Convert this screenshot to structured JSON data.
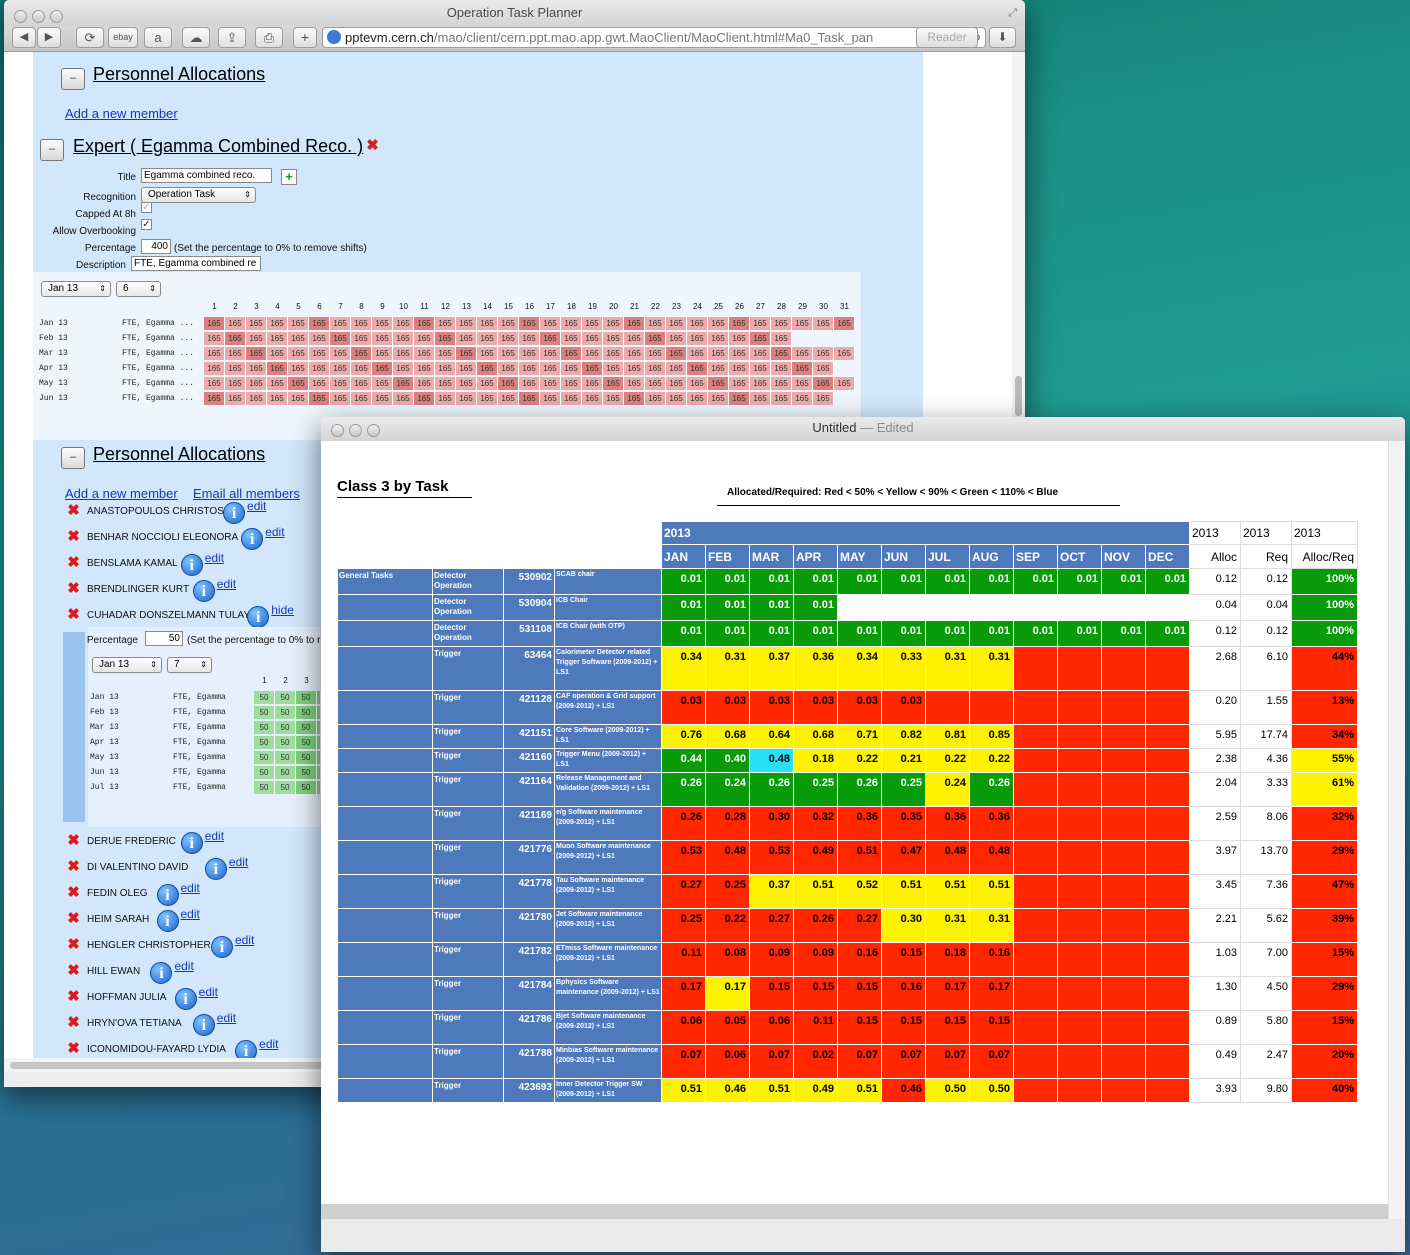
{
  "browser": {
    "title": "Operation Task Planner",
    "toolbar": {
      "ebay": "ebay",
      "reader": "Reader"
    },
    "url_host": "pptevm.cern.ch",
    "url_path": "/mao/client/cern.ppt.mao.app.gwt.MaoClient/MaoClient.html#Ma0_Task_pan",
    "minus_label": "–",
    "personnel1": {
      "title": "Personnel Allocations",
      "add_member": "Add a new member"
    },
    "expert": {
      "title": "Expert ( Egamma Combined Reco. )",
      "labels": {
        "title": "Title",
        "recognition": "Recognition",
        "capped": "Capped At 8h",
        "overbooking": "Allow Overbooking",
        "percentage": "Percentage",
        "description": "Description"
      },
      "title_value": "Egamma combined reco.",
      "recognition_value": "Operation Task",
      "percentage_value": "400",
      "percentage_note": "(Set the percentage to 0% to remove shifts)",
      "description_value": "FTE, Egamma combined re",
      "month_select": "Jan 13",
      "count_select": "6",
      "days": [
        "1",
        "2",
        "3",
        "4",
        "5",
        "6",
        "7",
        "8",
        "9",
        "10",
        "11",
        "12",
        "13",
        "14",
        "15",
        "16",
        "17",
        "18",
        "19",
        "20",
        "21",
        "22",
        "23",
        "24",
        "25",
        "26",
        "27",
        "28",
        "29",
        "30",
        "31"
      ],
      "rows": [
        {
          "month": "Jan 13",
          "label": "FTE, Egamma ...",
          "days": 31,
          "value": "165"
        },
        {
          "month": "Feb 13",
          "label": "FTE, Egamma ...",
          "days": 28,
          "value": "165"
        },
        {
          "month": "Mar 13",
          "label": "FTE, Egamma ...",
          "days": 31,
          "value": "165"
        },
        {
          "month": "Apr 13",
          "label": "FTE, Egamma ...",
          "days": 30,
          "value": "165"
        },
        {
          "month": "May 13",
          "label": "FTE, Egamma ...",
          "days": 31,
          "value": "165"
        },
        {
          "month": "Jun 13",
          "label": "FTE, Egamma ...",
          "days": 30,
          "value": "165"
        }
      ]
    },
    "personnel2": {
      "title": "Personnel Allocations",
      "add_member": "Add a new member",
      "email_all": "Email all members",
      "edit": "edit",
      "hide": "hide",
      "members_top": [
        "ANASTOPOULOS CHRISTOS",
        "BENHAR NOCCIOLI ELEONORA",
        "BENSLAMA KAMAL",
        "BRENDLINGER KURT",
        "CUHADAR DONSZELMANN TULAY"
      ],
      "sub": {
        "percentage_label": "Percentage",
        "percentage_value": "50",
        "note": "(Set the percentage to 0% to r",
        "month_select": "Jan 13",
        "count_select": "7",
        "days": [
          "1",
          "2",
          "3"
        ],
        "rows": [
          {
            "month": "Jan 13",
            "label": "FTE, Egamma"
          },
          {
            "month": "Feb 13",
            "label": "FTE, Egamma"
          },
          {
            "month": "Mar 13",
            "label": "FTE, Egamma"
          },
          {
            "month": "Apr 13",
            "label": "FTE, Egamma"
          },
          {
            "month": "May 13",
            "label": "FTE, Egamma"
          },
          {
            "month": "Jun 13",
            "label": "FTE, Egamma"
          },
          {
            "month": "Jul 13",
            "label": "FTE, Egamma"
          }
        ],
        "value": "50"
      },
      "members_bottom": [
        "DERUE FREDERIC",
        "DI VALENTINO DAVID",
        "FEDIN OLEG",
        "HEIM SARAH",
        "HENGLER CHRISTOPHER",
        "HILL EWAN",
        "HOFFMAN JULIA",
        "HRYN'OVA TETIANA",
        "ICONOMIDOU-FAYARD LYDIA"
      ]
    }
  },
  "editor": {
    "title": "Untitled",
    "edited": "— Edited",
    "report_title": "Class 3 by Task",
    "legend": "Allocated/Required: Red < 50% < Yellow < 90% < Green < 110% < Blue",
    "year": "2013",
    "months": [
      "JAN",
      "FEB",
      "MAR",
      "APR",
      "MAY",
      "JUN",
      "JUL",
      "AUG",
      "SEP",
      "OCT",
      "NOV",
      "DEC"
    ],
    "col_heads": [
      "Alloc",
      "Req",
      "Alloc/Req"
    ],
    "group": "General Tasks",
    "colors": {
      "R": "#ff2600",
      "Y": "#fff200",
      "G": "#0a9b0a",
      "B": "#27e0f5",
      "header": "#4e79bb"
    },
    "rows": [
      {
        "cat": "Detector Operation",
        "id": "530902",
        "desc": "SCAB chair",
        "vals": [
          "0.01",
          "0.01",
          "0.01",
          "0.01",
          "0.01",
          "0.01",
          "0.01",
          "0.01",
          "0.01",
          "0.01",
          "0.01",
          "0.01"
        ],
        "cls": "GGGGGGGGGGGG",
        "alloc": "0.12",
        "req": "0.12",
        "pct": "100%",
        "pcls": "G"
      },
      {
        "cat": "Detector Operation",
        "id": "530904",
        "desc": "ICB Chair",
        "vals": [
          "0.01",
          "0.01",
          "0.01",
          "0.01",
          "",
          "",
          "",
          "",
          "",
          "",
          "",
          ""
        ],
        "cls": "GGGGWWWWWWWW",
        "alloc": "0.04",
        "req": "0.04",
        "pct": "100%",
        "pcls": "G"
      },
      {
        "cat": "Detector Operation",
        "id": "531108",
        "desc": "ICB Chair (with OTP)",
        "vals": [
          "0.01",
          "0.01",
          "0.01",
          "0.01",
          "0.01",
          "0.01",
          "0.01",
          "0.01",
          "0.01",
          "0.01",
          "0.01",
          "0.01"
        ],
        "cls": "GGGGGGGGGGGG",
        "alloc": "0.12",
        "req": "0.12",
        "pct": "100%",
        "pcls": "G"
      },
      {
        "cat": "Trigger",
        "id": "63464",
        "desc": "Calorimeter Detector related Trigger Software (2009-2012) + LS1",
        "vals": [
          "0.34",
          "0.31",
          "0.37",
          "0.36",
          "0.34",
          "0.33",
          "0.31",
          "0.31",
          "",
          "",
          "",
          ""
        ],
        "cls": "YYYYYYYYRRRR",
        "alloc": "2.68",
        "req": "6.10",
        "pct": "44%",
        "pcls": "R"
      },
      {
        "cat": "Trigger",
        "id": "421128",
        "desc": "CAF operation & Grid support (2009-2012) + LS1",
        "vals": [
          "0.03",
          "0.03",
          "0.03",
          "0.03",
          "0.03",
          "0.03",
          "",
          "",
          "",
          "",
          "",
          ""
        ],
        "cls": "RRRRRRRRRRRR",
        "alloc": "0.20",
        "req": "1.55",
        "pct": "13%",
        "pcls": "R"
      },
      {
        "cat": "Trigger",
        "id": "421151",
        "desc": "Core Software (2009-2012) + LS1",
        "vals": [
          "0.76",
          "0.68",
          "0.64",
          "0.68",
          "0.71",
          "0.82",
          "0.81",
          "0.85",
          "",
          "",
          "",
          ""
        ],
        "cls": "YYYYYYYYRRRR",
        "alloc": "5.95",
        "req": "17.74",
        "pct": "34%",
        "pcls": "R"
      },
      {
        "cat": "Trigger",
        "id": "421160",
        "desc": "Trigger Menu (2009-2012) + LS1",
        "vals": [
          "0.44",
          "0.40",
          "0.48",
          "0.18",
          "0.22",
          "0.21",
          "0.22",
          "0.22",
          "",
          "",
          "",
          ""
        ],
        "cls": "GGBYYYYYRRRR",
        "alloc": "2.38",
        "req": "4.36",
        "pct": "55%",
        "pcls": "Y"
      },
      {
        "cat": "Trigger",
        "id": "421164",
        "desc": "Release Management and Validation (2009-2012) + LS1",
        "vals": [
          "0.26",
          "0.24",
          "0.26",
          "0.25",
          "0.26",
          "0.25",
          "0.24",
          "0.26",
          "",
          "",
          "",
          ""
        ],
        "cls": "GGGGGGYGRRRR",
        "alloc": "2.04",
        "req": "3.33",
        "pct": "61%",
        "pcls": "Y"
      },
      {
        "cat": "Trigger",
        "id": "421169",
        "desc": "e/g Software maintenance (2009-2012) + LS1",
        "vals": [
          "0.26",
          "0.28",
          "0.30",
          "0.32",
          "0.36",
          "0.35",
          "0.36",
          "0.36",
          "",
          "",
          "",
          ""
        ],
        "cls": "RRRRRRRRRRRR",
        "alloc": "2.59",
        "req": "8.06",
        "pct": "32%",
        "pcls": "R"
      },
      {
        "cat": "Trigger",
        "id": "421776",
        "desc": "Muon Software maintenance (2009-2012) + LS1",
        "vals": [
          "0.53",
          "0.48",
          "0.53",
          "0.49",
          "0.51",
          "0.47",
          "0.48",
          "0.48",
          "",
          "",
          "",
          ""
        ],
        "cls": "RRRRRRRRRRRR",
        "alloc": "3.97",
        "req": "13.70",
        "pct": "29%",
        "pcls": "R"
      },
      {
        "cat": "Trigger",
        "id": "421778",
        "desc": "Tau Software maintenance (2009-2012) + LS1",
        "vals": [
          "0.27",
          "0.25",
          "0.37",
          "0.51",
          "0.52",
          "0.51",
          "0.51",
          "0.51",
          "",
          "",
          "",
          ""
        ],
        "cls": "RRYYYYYYRRRR",
        "alloc": "3.45",
        "req": "7.36",
        "pct": "47%",
        "pcls": "R"
      },
      {
        "cat": "Trigger",
        "id": "421780",
        "desc": "Jet Software maintenance (2009-2012) + LS1",
        "vals": [
          "0.25",
          "0.22",
          "0.27",
          "0.26",
          "0.27",
          "0.30",
          "0.31",
          "0.31",
          "",
          "",
          "",
          ""
        ],
        "cls": "RRRRRYYYRRRR",
        "alloc": "2.21",
        "req": "5.62",
        "pct": "39%",
        "pcls": "R"
      },
      {
        "cat": "Trigger",
        "id": "421782",
        "desc": "ETmiss Software maintenance (2009-2012) + LS1",
        "vals": [
          "0.11",
          "0.08",
          "0.09",
          "0.09",
          "0.16",
          "0.15",
          "0.18",
          "0.16",
          "",
          "",
          "",
          ""
        ],
        "cls": "RRRRRRRRRRRR",
        "alloc": "1.03",
        "req": "7.00",
        "pct": "15%",
        "pcls": "R"
      },
      {
        "cat": "Trigger",
        "id": "421784",
        "desc": "Bphysics Software maintenance (2009-2012) + LS1",
        "vals": [
          "0.17",
          "0.17",
          "0.15",
          "0.15",
          "0.15",
          "0.16",
          "0.17",
          "0.17",
          "",
          "",
          "",
          ""
        ],
        "cls": "RYRRRRRRRRRR",
        "alloc": "1.30",
        "req": "4.50",
        "pct": "29%",
        "pcls": "R"
      },
      {
        "cat": "Trigger",
        "id": "421786",
        "desc": "Bjet Software maintenance (2009-2012) + LS1",
        "vals": [
          "0.06",
          "0.05",
          "0.06",
          "0.11",
          "0.15",
          "0.15",
          "0.15",
          "0.15",
          "",
          "",
          "",
          ""
        ],
        "cls": "RRRRRRRRRRRR",
        "alloc": "0.89",
        "req": "5.80",
        "pct": "15%",
        "pcls": "R"
      },
      {
        "cat": "Trigger",
        "id": "421788",
        "desc": "Minbias Software maintenance (2009-2012) + LS1",
        "vals": [
          "0.07",
          "0.06",
          "0.07",
          "0.02",
          "0.07",
          "0.07",
          "0.07",
          "0.07",
          "",
          "",
          "",
          ""
        ],
        "cls": "RRRRRRRRRRRR",
        "alloc": "0.49",
        "req": "2.47",
        "pct": "20%",
        "pcls": "R"
      },
      {
        "cat": "Trigger",
        "id": "423693",
        "desc": "Inner Detector Trigger SW (2009-2012) + LS1",
        "vals": [
          "0.51",
          "0.46",
          "0.51",
          "0.49",
          "0.51",
          "0.46",
          "0.50",
          "0.50",
          "",
          "",
          "",
          ""
        ],
        "cls": "YYYYYRYYRRRR",
        "alloc": "3.93",
        "req": "9.80",
        "pct": "40%",
        "pcls": "R"
      }
    ]
  }
}
